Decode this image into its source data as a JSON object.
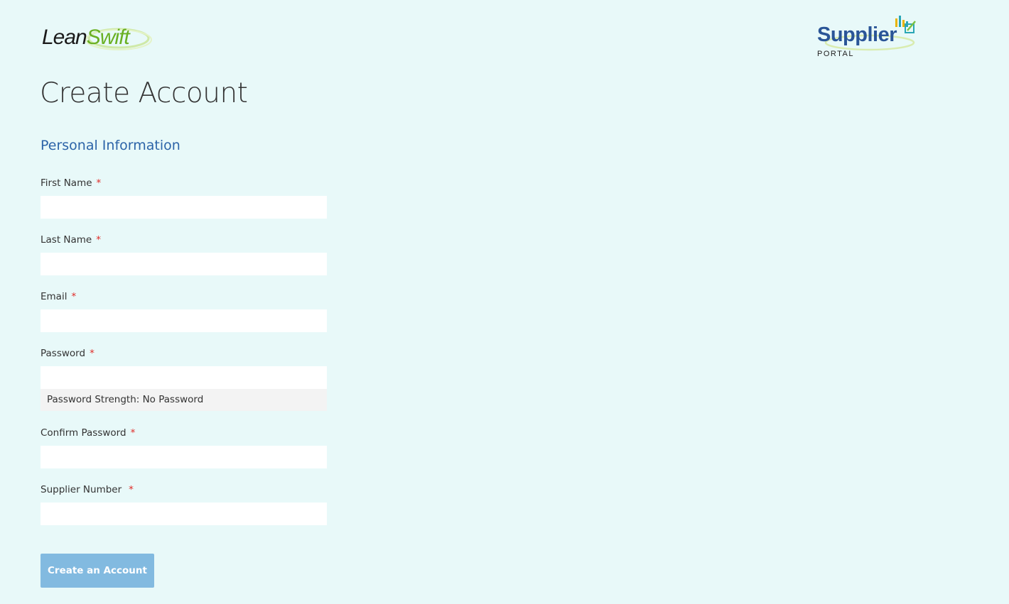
{
  "header": {
    "brand_logo": {
      "part1": "Lean",
      "part2": "Swift",
      "colors": {
        "dark": "#1a1a1a",
        "green": "#6ab023"
      }
    },
    "portal_logo": {
      "title": "Supplier",
      "subtitle": "PORTAL",
      "color": "#2a5597"
    }
  },
  "page_title": "Create Account",
  "section_title": "Personal Information",
  "required_marker": "*",
  "fields": [
    {
      "label": "First Name",
      "value": "",
      "placeholder": ""
    },
    {
      "label": "Last Name",
      "value": "",
      "placeholder": ""
    },
    {
      "label": "Email",
      "value": "",
      "placeholder": ""
    },
    {
      "label": "Password",
      "value": "",
      "placeholder": ""
    },
    {
      "label": "Confirm Password",
      "value": "",
      "placeholder": ""
    },
    {
      "label": "Supplier Number",
      "value": "",
      "placeholder": ""
    }
  ],
  "password_strength": "Password Strength: No Password",
  "submit_label": "Create an Account",
  "colors": {
    "background": "#e8f9f9",
    "accent": "#2c64a8",
    "button": "#82bae0",
    "required": "#e02b27"
  }
}
